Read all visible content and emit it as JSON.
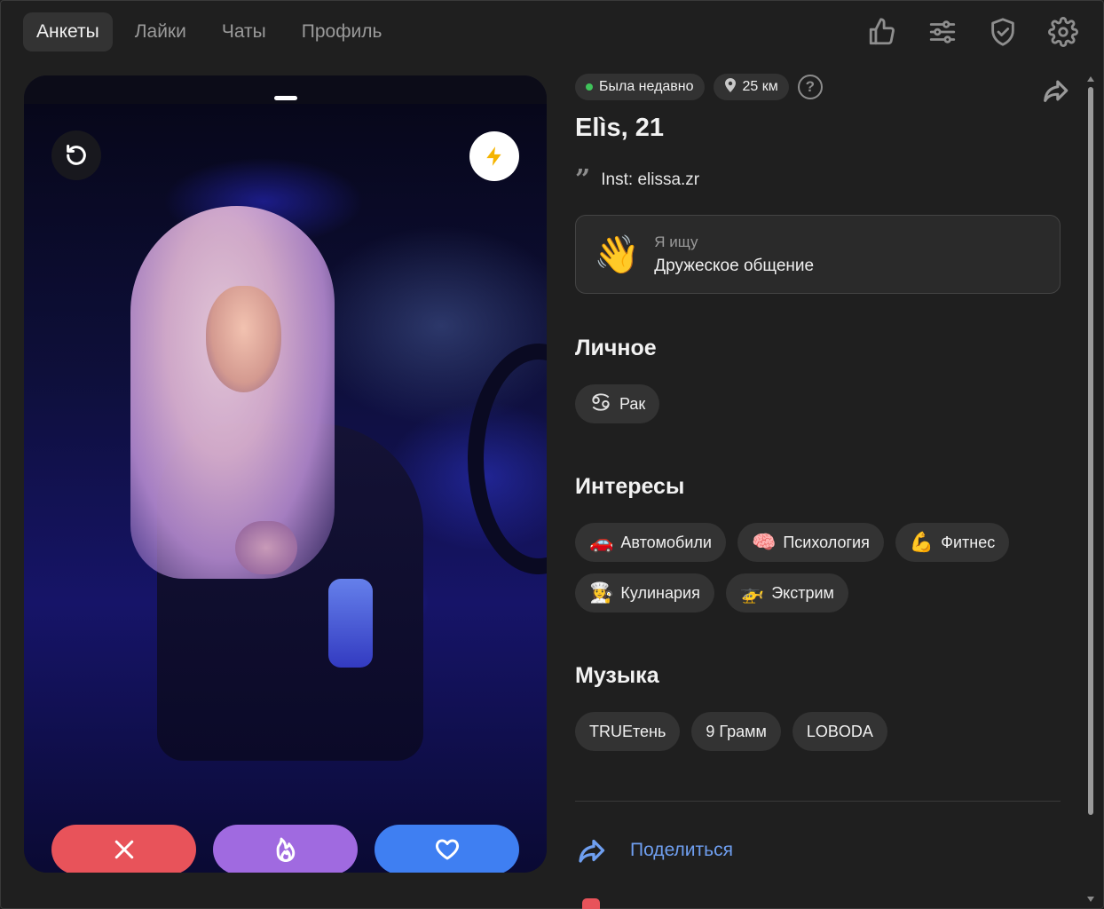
{
  "nav": {
    "tabs": [
      {
        "label": "Анкеты",
        "active": true
      },
      {
        "label": "Лайки"
      },
      {
        "label": "Чаты"
      },
      {
        "label": "Профиль"
      }
    ],
    "icons": [
      "thumbs-up-icon",
      "filters-icon",
      "shield-check-icon",
      "settings-gear-icon"
    ]
  },
  "card": {
    "photo_index": 1,
    "photo_count": 1,
    "undo_icon": "undo-icon",
    "boost_icon": "lightning-icon",
    "boost_color": "#f5b400",
    "actions": [
      {
        "icon": "close-icon",
        "color": "#e8535a"
      },
      {
        "icon": "flame-icon",
        "color": "#a06ae0"
      },
      {
        "icon": "heart-icon",
        "color": "#3f7ff2"
      }
    ]
  },
  "profile": {
    "status": "Была недавно",
    "status_color": "#3fc35a",
    "distance": "25 км",
    "help": "?",
    "name_age": "Elìs, 21",
    "bio": "Inst: elissa.zr",
    "looking_for": {
      "emoji": "👋",
      "label": "Я ищу",
      "value": "Дружеское общение"
    },
    "personal": {
      "title": "Личное",
      "items": [
        {
          "icon": "cancer-zodiac-icon",
          "label": "Рак"
        }
      ]
    },
    "interests": {
      "title": "Интересы",
      "items": [
        {
          "emoji": "🚗",
          "label": "Автомобили"
        },
        {
          "emoji": "🧠",
          "label": "Психология"
        },
        {
          "emoji": "💪",
          "label": "Фитнес"
        },
        {
          "emoji": "👩‍🍳",
          "label": "Кулинария"
        },
        {
          "emoji": "🚁",
          "label": "Экстрим"
        }
      ]
    },
    "music": {
      "title": "Музыка",
      "items": [
        "TRUEтень",
        "9 Грамм",
        "LOBODA"
      ]
    },
    "share_label": "Поделиться"
  },
  "colors": {
    "background": "#1f1f1f",
    "chip": "#333333",
    "link": "#6f9ff0"
  }
}
